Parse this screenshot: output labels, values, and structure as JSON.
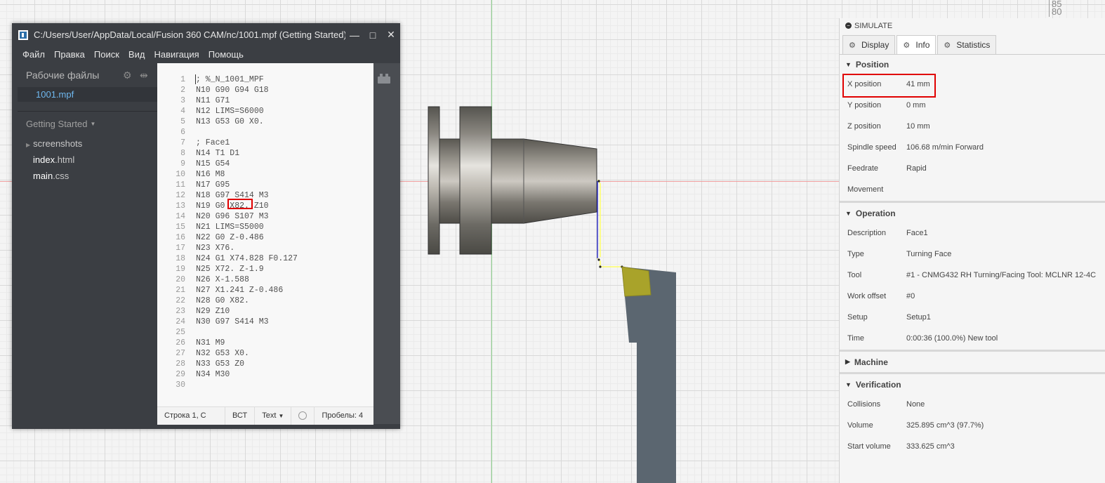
{
  "ruler": {
    "n1": "85",
    "n2": "80"
  },
  "editor": {
    "title": "C:/Users/User/AppData/Local/Fusion 360 CAM/nc/1001.mpf (Getting Started) - ...",
    "menu": [
      "Файл",
      "Правка",
      "Поиск",
      "Вид",
      "Навигация",
      "Помощь"
    ],
    "sidebar": {
      "working_files_label": "Рабочие файлы",
      "open_file": "1001.mpf",
      "project_label": "Getting Started",
      "tree": [
        {
          "name": "screenshots",
          "ext": ""
        },
        {
          "name": "index",
          "ext": ".html"
        },
        {
          "name": "main",
          "ext": ".css"
        }
      ]
    },
    "code_lines": [
      "; %_N_1001_MPF",
      "N10 G90 G94 G18",
      "N11 G71",
      "N12 LIMS=S6000",
      "N13 G53 G0 X0.",
      "",
      "; Face1",
      "N14 T1 D1",
      "N15 G54",
      "N16 M8",
      "N17 G95",
      "N18 G97 S414 M3",
      "N19 G0 X82. Z10",
      "N20 G96 S107 M3",
      "N21 LIMS=S5000",
      "N22 G0 Z-0.486",
      "N23 X76.",
      "N24 G1 X74.828 F0.127",
      "N25 X72. Z-1.9",
      "N26 X-1.588",
      "N27 X1.241 Z-0.486",
      "N28 G0 X82.",
      "N29 Z10",
      "N30 G97 S414 M3",
      "",
      "N31 M9",
      "N32 G53 X0.",
      "N33 G53 Z0",
      "N34 M30",
      ""
    ],
    "status": {
      "position": "Строка 1, С",
      "mode": "ВСТ",
      "language": "Text",
      "spaces": "Пробелы:  4"
    }
  },
  "simulate": {
    "header": "SIMULATE",
    "tabs": [
      "Display",
      "Info",
      "Statistics"
    ],
    "active_tab": "Info",
    "sections": {
      "position": {
        "title": "Position",
        "rows": [
          {
            "k": "X position",
            "v": "41 mm"
          },
          {
            "k": "Y position",
            "v": "0 mm"
          },
          {
            "k": "Z position",
            "v": "10 mm"
          },
          {
            "k": "Spindle speed",
            "v": "106.68 m/min Forward"
          },
          {
            "k": "Feedrate",
            "v": "Rapid"
          },
          {
            "k": "Movement",
            "v": ""
          }
        ]
      },
      "operation": {
        "title": "Operation",
        "rows": [
          {
            "k": "Description",
            "v": "Face1"
          },
          {
            "k": "Type",
            "v": "Turning Face"
          },
          {
            "k": "Tool",
            "v": "#1 - CNMG432 RH Turning/Facing Tool: MCLNR 12-4C"
          },
          {
            "k": "Work offset",
            "v": "#0"
          },
          {
            "k": "Setup",
            "v": "Setup1"
          },
          {
            "k": "Time",
            "v": "0:00:36 (100.0%) New tool"
          }
        ]
      },
      "machine": {
        "title": "Machine"
      },
      "verification": {
        "title": "Verification",
        "rows": [
          {
            "k": "Collisions",
            "v": "None"
          },
          {
            "k": "Volume",
            "v": "325.895 cm^3 (97.7%)"
          },
          {
            "k": "Start volume",
            "v": "333.625 cm^3"
          }
        ]
      }
    }
  },
  "colors": {
    "editor_bg": "#3b3e43",
    "highlight": "#e00000",
    "tool_insert": "#a9a32a",
    "tool_holder": "#5b6670",
    "toolpath_rapid": "#ffff66",
    "toolpath_feed": "#3030c0"
  }
}
